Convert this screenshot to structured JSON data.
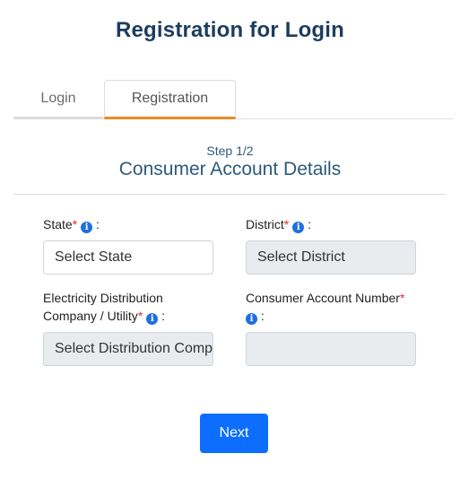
{
  "page": {
    "title": "Registration for Login"
  },
  "tabs": [
    {
      "label": "Login",
      "active": false
    },
    {
      "label": "Registration",
      "active": true
    }
  ],
  "form": {
    "step": "Step 1/2",
    "section_title": "Consumer Account Details",
    "state": {
      "label": "State",
      "required_mark": "*",
      "colon": ":",
      "value": "Select State"
    },
    "district": {
      "label": "District",
      "required_mark": "*",
      "colon": ":",
      "value": "Select District"
    },
    "utility": {
      "label_line1": "Electricity Distribution",
      "label_line2": "Company / Utility",
      "required_mark": "*",
      "colon": ":",
      "value": "Select Distribution Company"
    },
    "account_number": {
      "label": "Consumer Account Number",
      "required_mark": "*",
      "colon": ":",
      "value": ""
    },
    "next_label": "Next"
  },
  "icons": {
    "info": "info-icon"
  },
  "colors": {
    "accent": "#ec8a24",
    "primary": "#0d6efd",
    "title": "#1c3d5e",
    "required": "#d9302c"
  }
}
